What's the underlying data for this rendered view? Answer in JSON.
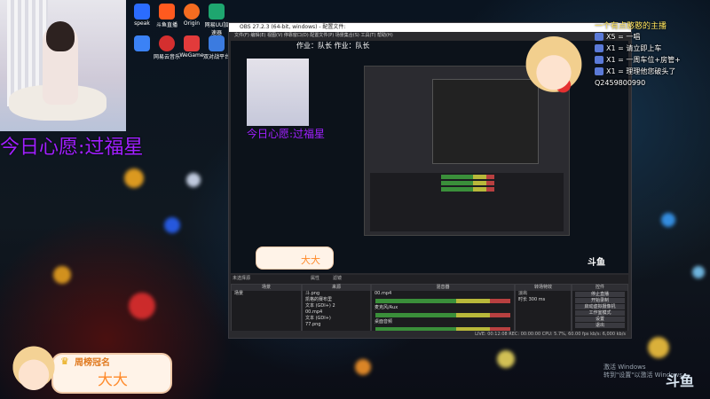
{
  "overlay": {
    "wish_text": "今日心愿:过福星",
    "chat_title": "一个有点憨憨的主播",
    "chat_lines": [
      {
        "count": "X5",
        "text": "= 一唱"
      },
      {
        "count": "X1",
        "text": "= 请立即上车"
      },
      {
        "count": "X1",
        "text": "= 一周车位+房管+"
      },
      {
        "count": "X1",
        "text": "= 理理他您破头了"
      }
    ],
    "chat_id": "Q2459800990",
    "top_rank_label": "周榜冠名",
    "top_rank_name": "大大",
    "small_rank_name": "大大",
    "platform_logo": "斗鱼",
    "windows_activate_1": "激活 Windows",
    "windows_activate_2": "转到\"设置\"以激活 Windows。"
  },
  "desktop_icons": [
    {
      "label": "speak",
      "color": "#2b6cff"
    },
    {
      "label": "斗鱼直播",
      "color": "#ff5a1f"
    },
    {
      "label": "Origin",
      "color": "#f56c20"
    },
    {
      "label": "网易UU加速器",
      "color": "#1ea66f"
    },
    {
      "label": "",
      "color": "#3b82f6"
    },
    {
      "label": "网易云音乐",
      "color": "#d42f2f"
    },
    {
      "label": "WeGame",
      "color": "#e23b3b"
    },
    {
      "label": "双对战平台",
      "color": "#3b7be0"
    }
  ],
  "obs": {
    "title": "OBS 27.2.3 (64-bit, windows) - 配置文件:",
    "header_text": "作业：队长 作业：队长",
    "menu": "文件(F)  编辑(E)  视图(V)  停靠窗口(D)  配置文件(P)  场景集合(S)  工具(T)  帮助(H)",
    "source_label": "未选择源",
    "props_label": "属性",
    "filters_label": "滤镜",
    "panels": {
      "scenes": "场景",
      "sources": "来源",
      "mixer": "混音器",
      "transitions": "转场特效",
      "controls": "控件"
    },
    "scene_items": [
      "场景"
    ],
    "source_items": [
      "斗.png",
      "凯格的赛布里",
      "文本 (GDI+) 2",
      "00.mp4",
      "文本 (GDI+)",
      "77.png"
    ],
    "mixer_tracks": [
      {
        "name": "00.mp4",
        "db": "0.0 dB"
      },
      {
        "name": "麦克风/Aux",
        "db": "0.0 dB"
      },
      {
        "name": "桌面音频",
        "db": "0.0 dB"
      }
    ],
    "transition": {
      "type": "淡出",
      "duration_label": "时长",
      "duration": "300 ms"
    },
    "controls": [
      "停止直播",
      "开始录制",
      "启动虚拟摄像机",
      "工作室模式",
      "设置",
      "退出"
    ],
    "status": "LIVE: 00:12:08   REC: 00:00:00   CPU: 5.7%, 60.00 fps   kb/s: 6,000 kb/s"
  }
}
